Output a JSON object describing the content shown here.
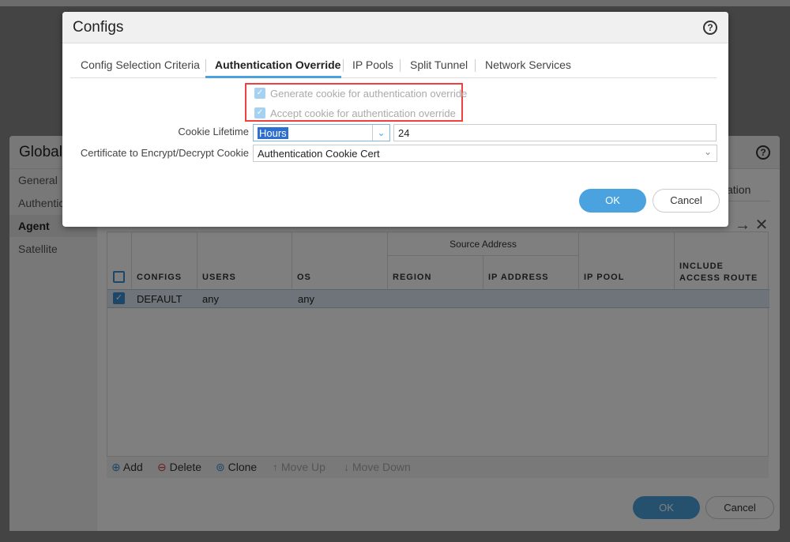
{
  "global_dialog": {
    "title": "GlobalP",
    "help": "?",
    "sidebar": [
      {
        "label": "General"
      },
      {
        "label": "Authentic"
      },
      {
        "label": "Agent",
        "selected": true
      },
      {
        "label": "Satellite"
      }
    ],
    "tab_fragment": "ation",
    "table": {
      "group_header": "Source Address",
      "columns": [
        "CONFIGS",
        "USERS",
        "OS",
        "REGION",
        "IP ADDRESS",
        "IP POOL",
        "INCLUDE ACCESS ROUTE"
      ],
      "rows": [
        {
          "checked": true,
          "configs": "DEFAULT",
          "users": "any",
          "os": "any",
          "region": "",
          "ip_address": "",
          "ip_pool": "",
          "include_access_route": ""
        }
      ]
    },
    "toolbar": {
      "add": "Add",
      "delete": "Delete",
      "clone": "Clone",
      "move_up": "Move Up",
      "move_down": "Move Down"
    },
    "ok": "OK",
    "cancel": "Cancel"
  },
  "configs_dialog": {
    "title": "Configs",
    "help": "?",
    "tabs": [
      {
        "label": "Config Selection Criteria"
      },
      {
        "label": "Authentication Override",
        "active": true
      },
      {
        "label": "IP Pools"
      },
      {
        "label": "Split Tunnel"
      },
      {
        "label": "Network Services"
      }
    ],
    "generate_cookie": {
      "label": "Generate cookie for authentication override",
      "checked": true,
      "disabled": true
    },
    "accept_cookie": {
      "label": "Accept cookie for authentication override",
      "checked": true,
      "disabled": true
    },
    "cookie_lifetime": {
      "label": "Cookie Lifetime",
      "unit": "Hours",
      "value": "24"
    },
    "certificate": {
      "label": "Certificate to Encrypt/Decrypt Cookie",
      "value": "Authentication Cookie Cert"
    },
    "ok": "OK",
    "cancel": "Cancel"
  },
  "colors": {
    "accent": "#4aa3df",
    "highlight": "#f04040"
  }
}
